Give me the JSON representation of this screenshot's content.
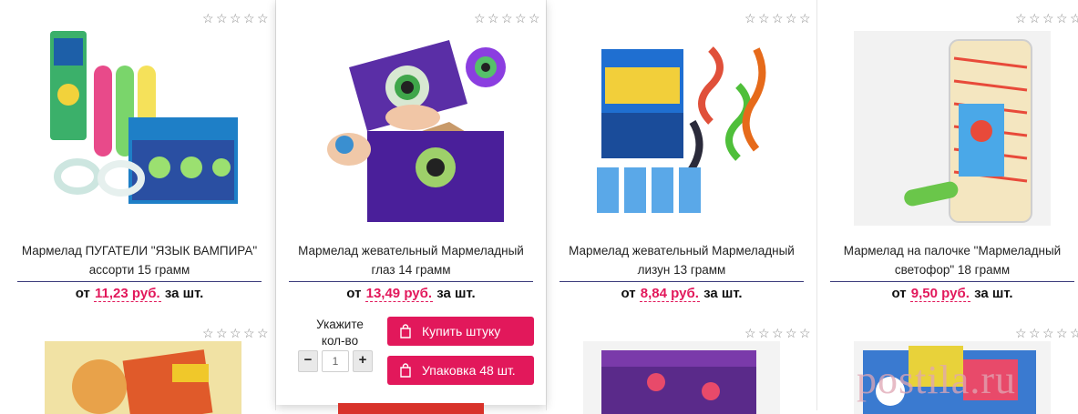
{
  "products": [
    {
      "name": "Мармелад ПУГАТЕЛИ \"ЯЗЫК ВАМПИРА\" ассорти 15 грамм",
      "price_prefix": "от",
      "price": "11,23 руб.",
      "price_suffix": "за шт.",
      "image": "vampire-tongue-box",
      "rating": 0
    },
    {
      "name": "Мармелад жевательный Мармеладный глаз 14 грамм",
      "price_prefix": "от",
      "price": "13,49 руб.",
      "price_suffix": "за шт.",
      "image": "marmalade-eye-box",
      "rating": 0
    },
    {
      "name": "Мармелад жевательный Мармеладный лизун 13 грамм",
      "price_prefix": "от",
      "price": "8,84 руб.",
      "price_suffix": "за шт.",
      "image": "slime-hands-box",
      "rating": 0
    },
    {
      "name": "Мармелад на палочке \"Мармеладный светофор\" 18 грамм",
      "price_prefix": "от",
      "price": "9,50 руб.",
      "price_suffix": "за шт.",
      "image": "traffic-light-tube",
      "rating": 0
    }
  ],
  "hover_controls": {
    "qty_label": "Укажите кол-во",
    "qty_value": "1",
    "minus": "−",
    "plus": "+",
    "buy_single": "Купить штуку",
    "buy_pack": "Упаковка 48 шт."
  },
  "row2_images": [
    "pizza-marmalade",
    "candy-box-red",
    "purple-candy-box",
    "colorful-candy-box"
  ],
  "watermark": "postila.ru",
  "colors": {
    "accent": "#e2185b",
    "divider": "#3a3a7a",
    "star": "#8a8a8a"
  }
}
